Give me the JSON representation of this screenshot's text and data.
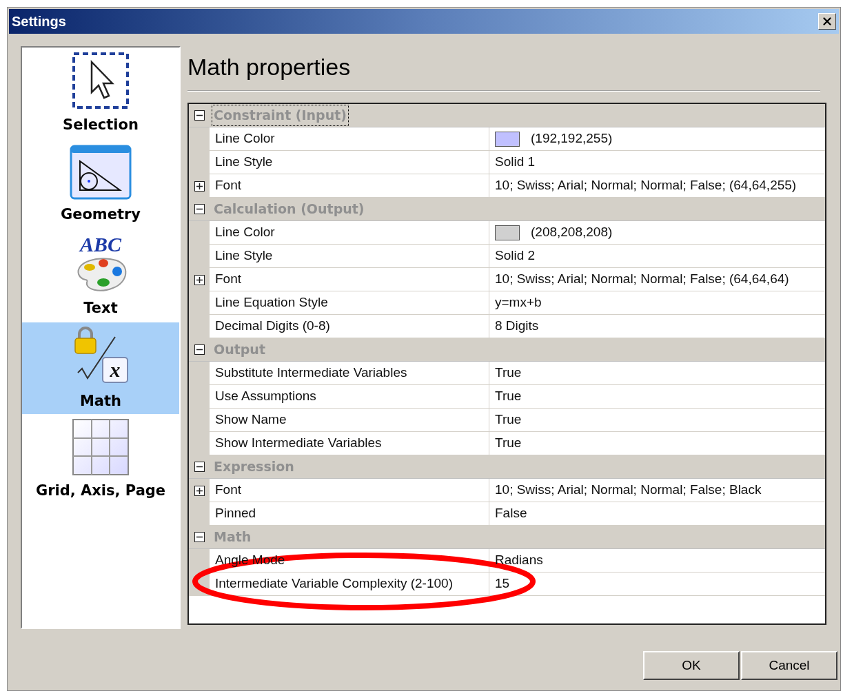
{
  "window": {
    "title": "Settings"
  },
  "sidebar": {
    "items": [
      {
        "label": "Selection",
        "kind": "selection",
        "selected": false
      },
      {
        "label": "Geometry",
        "kind": "geometry",
        "selected": false
      },
      {
        "label": "Text",
        "kind": "text",
        "icon_text": "ABC",
        "selected": false
      },
      {
        "label": "Math",
        "kind": "math",
        "icon_text": "x",
        "selected": true
      },
      {
        "label": "Grid, Axis, Page",
        "kind": "grid",
        "selected": false
      }
    ]
  },
  "heading": "Math properties",
  "property_grid": {
    "sections": [
      {
        "title": "Constraint (Input)",
        "expanded": true,
        "focused": true,
        "rows": [
          {
            "name": "Line Color",
            "value": "(192,192,255)",
            "color": "#c0c0ff"
          },
          {
            "name": "Line Style",
            "value": "Solid 1"
          },
          {
            "name": "Font",
            "value": "10; Swiss; Arial; Normal; Normal; False; (64,64,255)",
            "expandable": true
          }
        ]
      },
      {
        "title": "Calculation (Output)",
        "expanded": true,
        "focused": false,
        "rows": [
          {
            "name": "Line Color",
            "value": "(208,208,208)",
            "color": "#d0d0d0"
          },
          {
            "name": "Line Style",
            "value": "Solid 2"
          },
          {
            "name": "Font",
            "value": "10; Swiss; Arial; Normal; Normal; False; (64,64,64)",
            "expandable": true
          },
          {
            "name": "Line Equation Style",
            "value": "y=mx+b"
          },
          {
            "name": "Decimal Digits (0-8)",
            "value": "8 Digits"
          }
        ]
      },
      {
        "title": "Output",
        "expanded": true,
        "focused": false,
        "rows": [
          {
            "name": "Substitute Intermediate Variables",
            "value": "True"
          },
          {
            "name": "Use Assumptions",
            "value": "True"
          },
          {
            "name": "Show Name",
            "value": "True"
          },
          {
            "name": "Show Intermediate Variables",
            "value": "True"
          }
        ]
      },
      {
        "title": "Expression",
        "expanded": true,
        "focused": false,
        "rows": [
          {
            "name": "Font",
            "value": "10; Swiss; Arial; Normal; Normal; False; Black",
            "expandable": true
          },
          {
            "name": "Pinned",
            "value": "False"
          }
        ]
      },
      {
        "title": "Math",
        "expanded": true,
        "focused": false,
        "rows": [
          {
            "name": "Angle Mode",
            "value": "Radians"
          },
          {
            "name": "Intermediate Variable Complexity (2-100)",
            "value": "15"
          }
        ]
      }
    ]
  },
  "buttons": [
    {
      "label": "OK"
    },
    {
      "label": "Cancel"
    }
  ]
}
